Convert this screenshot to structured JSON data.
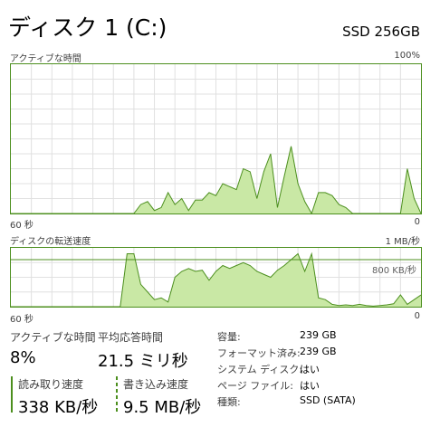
{
  "header": {
    "title": "ディスク 1 (C:)",
    "model": "SSD 256GB"
  },
  "activity_chart": {
    "label": "アクティブな時間",
    "max_label": "100%",
    "time_left": "60 秒",
    "time_right": "0"
  },
  "transfer_chart": {
    "label": "ディスクの転送速度",
    "max_label": "1 MB/秒",
    "ref_line_label": "800 KB/秒",
    "time_left": "60 秒",
    "time_right": "0"
  },
  "stats": {
    "active_time": {
      "label": "アクティブな時間",
      "value": "8%"
    },
    "avg_response": {
      "label": "平均応答時間",
      "value": "21.5 ミリ秒"
    },
    "read_speed": {
      "label": "読み取り速度",
      "value": "338 KB/秒"
    },
    "write_speed": {
      "label": "書き込み速度",
      "value": "9.5 MB/秒"
    }
  },
  "properties": [
    {
      "label": "容量:",
      "value": "239 GB"
    },
    {
      "label": "フォーマット済み:",
      "value": "239 GB"
    },
    {
      "label": "システム ディスク:",
      "value": "はい"
    },
    {
      "label": "ページ ファイル:",
      "value": "はい"
    },
    {
      "label": "種類:",
      "value": "SSD (SATA)"
    }
  ],
  "colors": {
    "line": "#4c8f1e",
    "fill": "#c9e8a5",
    "grid": "#e0e0e0"
  },
  "chart_data": [
    {
      "type": "area",
      "name": "activity",
      "xlim": [
        60,
        0
      ],
      "ylim": [
        0,
        100
      ],
      "x": [
        60,
        43,
        42,
        41,
        40,
        39,
        38,
        37,
        36,
        35,
        34,
        33,
        32,
        31,
        30,
        29,
        28,
        27,
        26,
        25,
        24,
        23,
        22,
        21,
        20,
        19,
        18,
        17,
        16,
        15,
        14,
        13,
        12,
        11,
        10,
        9,
        8,
        7,
        6,
        5,
        4,
        3,
        2,
        1,
        0
      ],
      "y": [
        0,
        0,
        0,
        6,
        8,
        2,
        4,
        14,
        6,
        10,
        2,
        9,
        9,
        14,
        12,
        20,
        18,
        16,
        30,
        28,
        10,
        28,
        40,
        4,
        25,
        45,
        20,
        8,
        0,
        14,
        14,
        12,
        6,
        4,
        0,
        0,
        0,
        0,
        0,
        0,
        0,
        0,
        30,
        10,
        0
      ]
    },
    {
      "type": "area",
      "name": "transfer",
      "xlim": [
        60,
        0
      ],
      "ylim": [
        0,
        1000
      ],
      "ref_lines": [
        800
      ],
      "x": [
        60,
        44,
        43,
        42,
        41,
        40,
        39,
        38,
        37,
        36,
        35,
        34,
        33,
        32,
        31,
        30,
        29,
        28,
        27,
        26,
        25,
        24,
        23,
        22,
        21,
        20,
        19,
        18,
        17,
        16,
        15,
        14,
        13,
        12,
        11,
        10,
        9,
        8,
        7,
        6,
        5,
        4,
        3,
        2,
        1,
        0
      ],
      "y": [
        0,
        0,
        900,
        900,
        380,
        250,
        120,
        150,
        80,
        500,
        600,
        650,
        600,
        620,
        450,
        600,
        700,
        650,
        700,
        750,
        700,
        600,
        550,
        500,
        620,
        700,
        800,
        900,
        600,
        900,
        150,
        120,
        40,
        20,
        30,
        20,
        40,
        20,
        10,
        20,
        30,
        50,
        200,
        40,
        120,
        200
      ]
    }
  ]
}
